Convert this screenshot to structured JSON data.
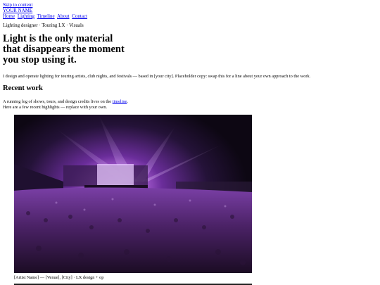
{
  "skip_link": "Skip to content",
  "site_name": "YOUR NAME",
  "nav": [
    "Home",
    "Lighting",
    "Timeline",
    "About",
    "Contact"
  ],
  "tagline": "Lighting designer · Touring LX · Visuals",
  "headline_lines": [
    "Light is the only material",
    "that disappears the moment",
    "you stop using it."
  ],
  "intro": "I design and operate lighting for touring artists, club nights, and festivals — based in [your city]. Placeholder copy: swap this for a line about your own approach to the work.",
  "recent": {
    "title": "Recent work",
    "line1_before": "A running log of shows, tours, and design credits lives on the ",
    "line1_link": "timeline",
    "line1_after": ".",
    "line2": "Here are a few recent highlights — replace with your own."
  },
  "featured": {
    "caption": "[Artist Name] — [Venue], [City] · LX design + op"
  }
}
